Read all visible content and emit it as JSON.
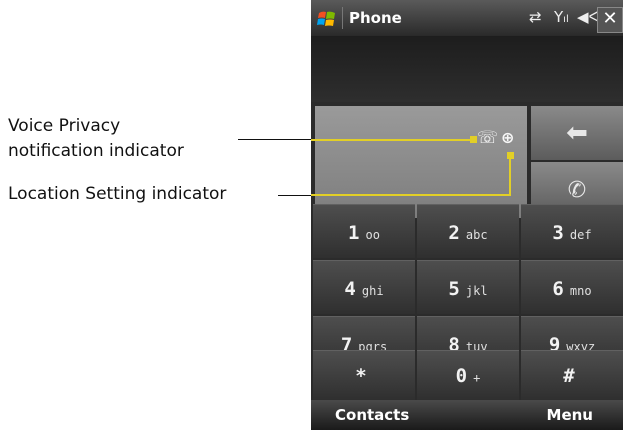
{
  "callouts": {
    "voice_privacy_line1": "Voice Privacy",
    "voice_privacy_line2": "notification indicator",
    "location_setting": "Location Setting indicator"
  },
  "titlebar": {
    "title": "Phone",
    "icons": [
      "windows-start-icon",
      "connectivity-icon",
      "signal-icon",
      "volume-icon",
      "close-icon"
    ],
    "close_label": "✕"
  },
  "display": {
    "voice_privacy_icon": "voice-privacy-icon",
    "location_icon": "location-setting-icon",
    "backspace_icon": "backspace-arrow-icon",
    "call_button_icon": "call-phone-icon"
  },
  "keypad": [
    {
      "digit": "1",
      "letters": "oo"
    },
    {
      "digit": "2",
      "letters": "abc"
    },
    {
      "digit": "3",
      "letters": "def"
    },
    {
      "digit": "4",
      "letters": "ghi"
    },
    {
      "digit": "5",
      "letters": "jkl"
    },
    {
      "digit": "6",
      "letters": "mno"
    },
    {
      "digit": "7",
      "letters": "pqrs"
    },
    {
      "digit": "8",
      "letters": "tuv"
    },
    {
      "digit": "9",
      "letters": "wxyz"
    },
    {
      "digit": "*",
      "letters": ""
    },
    {
      "digit": "0",
      "letters": "+"
    },
    {
      "digit": "#",
      "letters": ""
    }
  ],
  "softkeys": {
    "left": "Contacts",
    "right": "Menu"
  },
  "colors": {
    "indicator_line": "#e2cf26"
  }
}
